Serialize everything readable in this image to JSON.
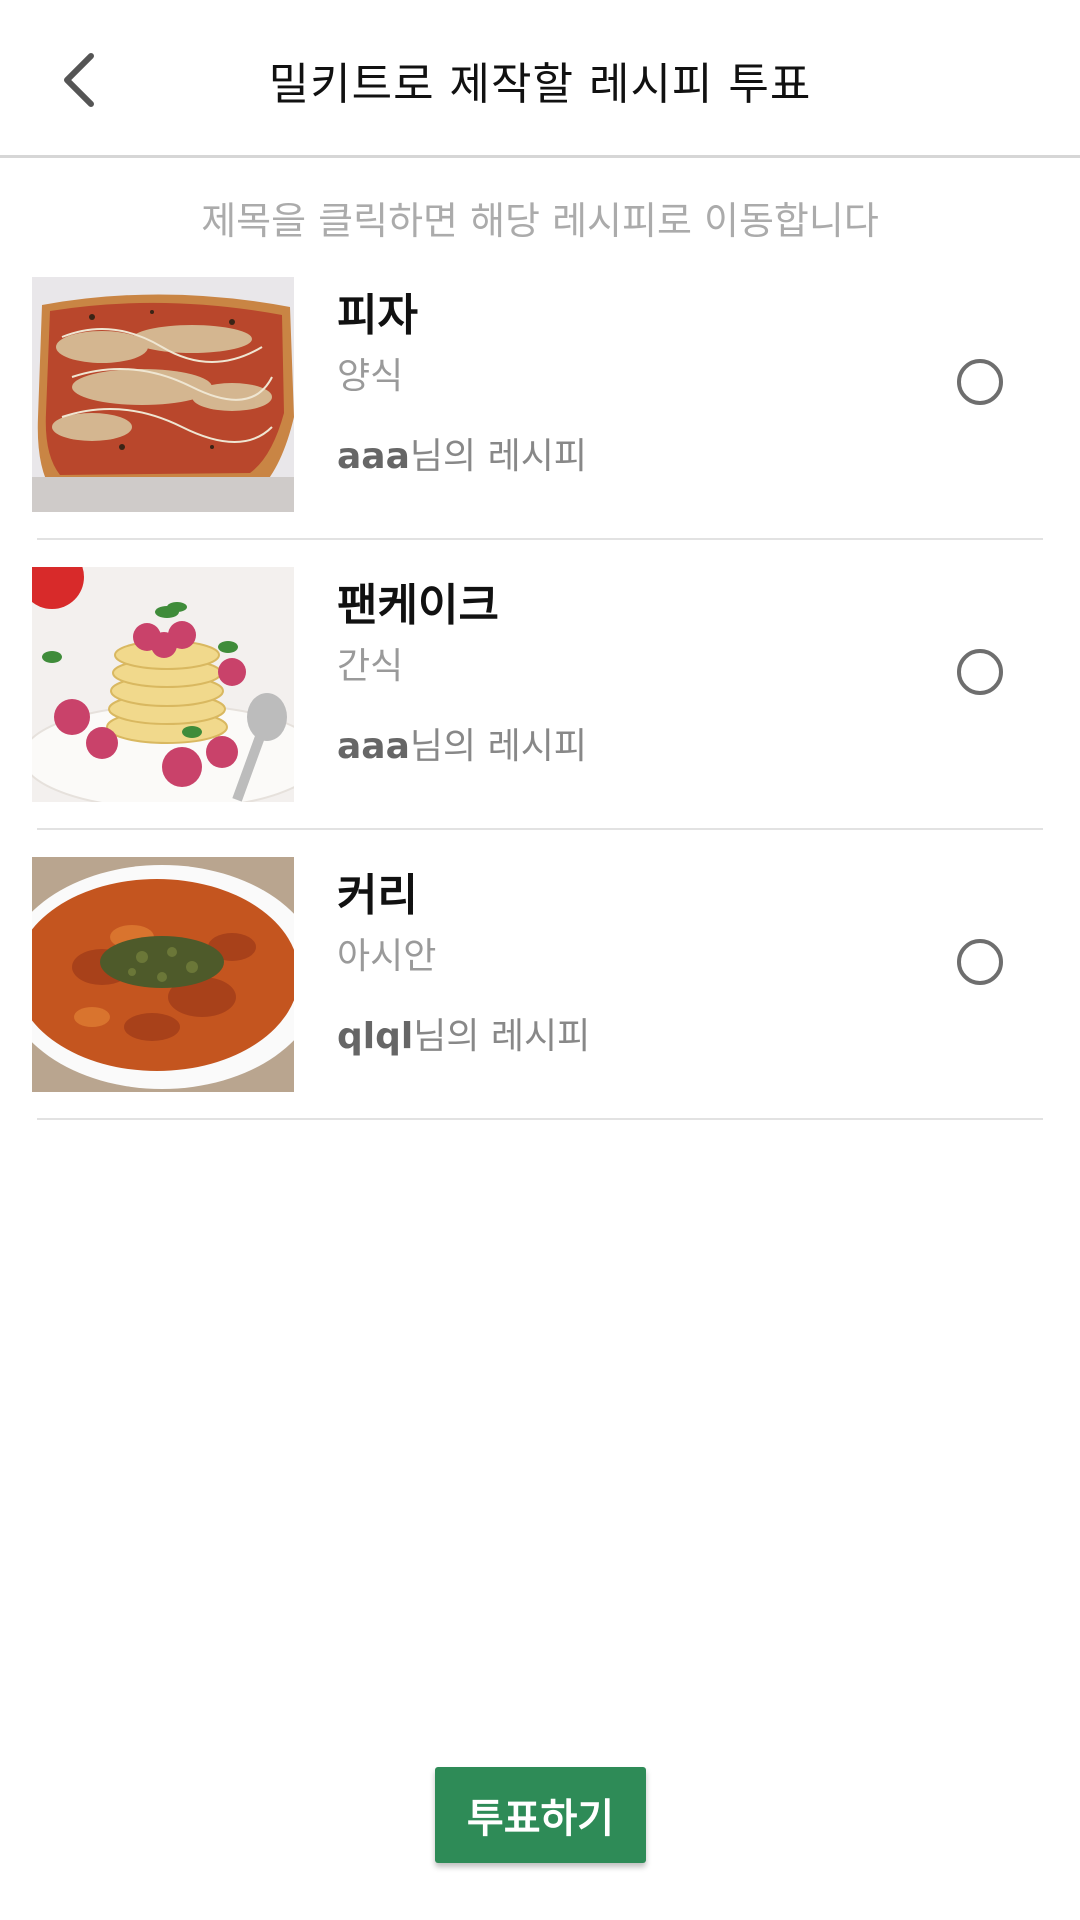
{
  "header": {
    "title": "밀키트로 제작할 레시피 투표",
    "back_icon": "chevron-left-icon"
  },
  "hint": "제목을 클릭하면 해당 레시피로 이동합니다",
  "recipes": [
    {
      "name": "피자",
      "category": "양식",
      "author": "aaa",
      "author_suffix": "님의 레시피",
      "selected": false
    },
    {
      "name": "팬케이크",
      "category": "간식",
      "author": "aaa",
      "author_suffix": "님의 레시피",
      "selected": false
    },
    {
      "name": "커리",
      "category": "아시안",
      "author": "qlql",
      "author_suffix": "님의 레시피",
      "selected": false
    }
  ],
  "vote_button": {
    "label": "투표하기",
    "color": "#2e8b57"
  }
}
